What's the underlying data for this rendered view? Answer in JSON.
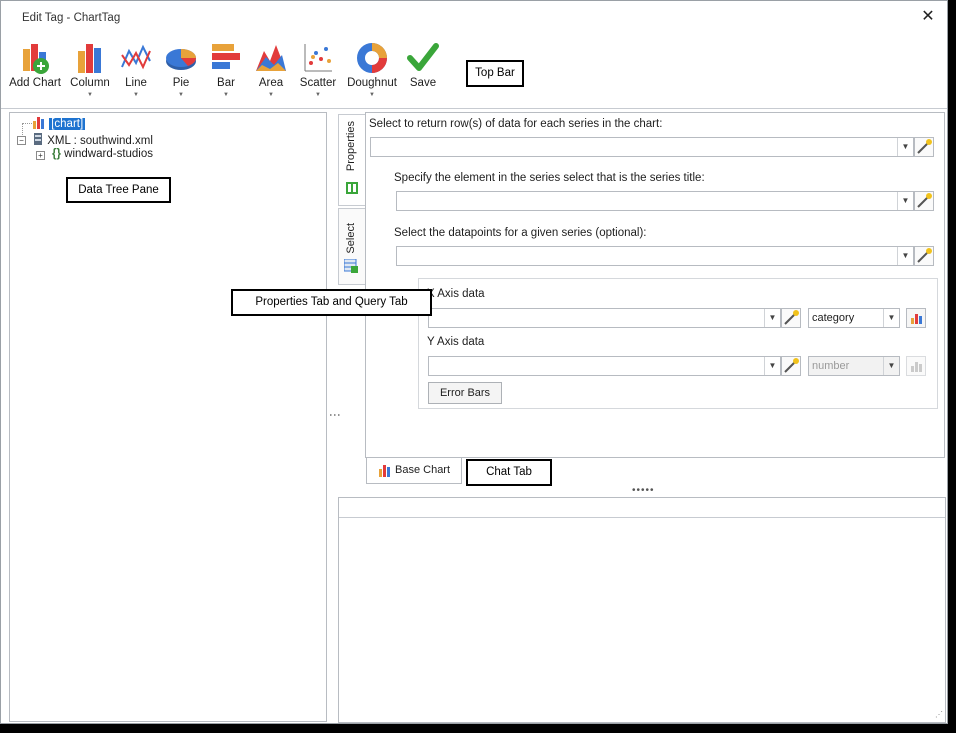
{
  "window": {
    "title": "Edit Tag - ChartTag",
    "close_icon": "close-icon"
  },
  "ribbon": {
    "buttons": [
      {
        "label": "Add Chart",
        "icon": "add-chart-icon",
        "dropdown": false
      },
      {
        "label": "Column",
        "icon": "column-chart-icon",
        "dropdown": true
      },
      {
        "label": "Line",
        "icon": "line-chart-icon",
        "dropdown": true
      },
      {
        "label": "Pie",
        "icon": "pie-chart-icon",
        "dropdown": true
      },
      {
        "label": "Bar",
        "icon": "bar-chart-icon",
        "dropdown": true
      },
      {
        "label": "Area",
        "icon": "area-chart-icon",
        "dropdown": true
      },
      {
        "label": "Scatter",
        "icon": "scatter-chart-icon",
        "dropdown": true
      },
      {
        "label": "Doughnut",
        "icon": "doughnut-chart-icon",
        "dropdown": true
      },
      {
        "label": "Save",
        "icon": "save-checkmark-icon",
        "dropdown": false
      }
    ],
    "caret": "▼"
  },
  "callouts": {
    "top_bar": "Top Bar",
    "data_tree": "Data Tree Pane",
    "properties_query": "Properties Tab and Query Tab",
    "chat_tab": "Chat Tab"
  },
  "tree": {
    "nodes": [
      {
        "label": "[chart]",
        "selected": true
      },
      {
        "label": "XML : southwind.xml",
        "selected": false
      },
      {
        "label": "windward-studios",
        "selected": false
      }
    ]
  },
  "side_tabs": {
    "properties": "Properties",
    "select": "Select"
  },
  "properties": {
    "series_label": "Select to return row(s) of data for each series in the chart:",
    "series_title_label": "Specify the element in the series select that is the series title:",
    "datapoints_label": "Select the datapoints for a given series (optional):",
    "x_axis_label": "X Axis data",
    "x_axis_type": "category",
    "y_axis_label": "Y Axis data",
    "y_axis_type": "number",
    "error_bars_button": "Error Bars"
  },
  "bottom_tab": {
    "label": "Base Chart"
  },
  "colors": {
    "selection": "#1e73d0",
    "accent_green": "#3aa63a"
  }
}
